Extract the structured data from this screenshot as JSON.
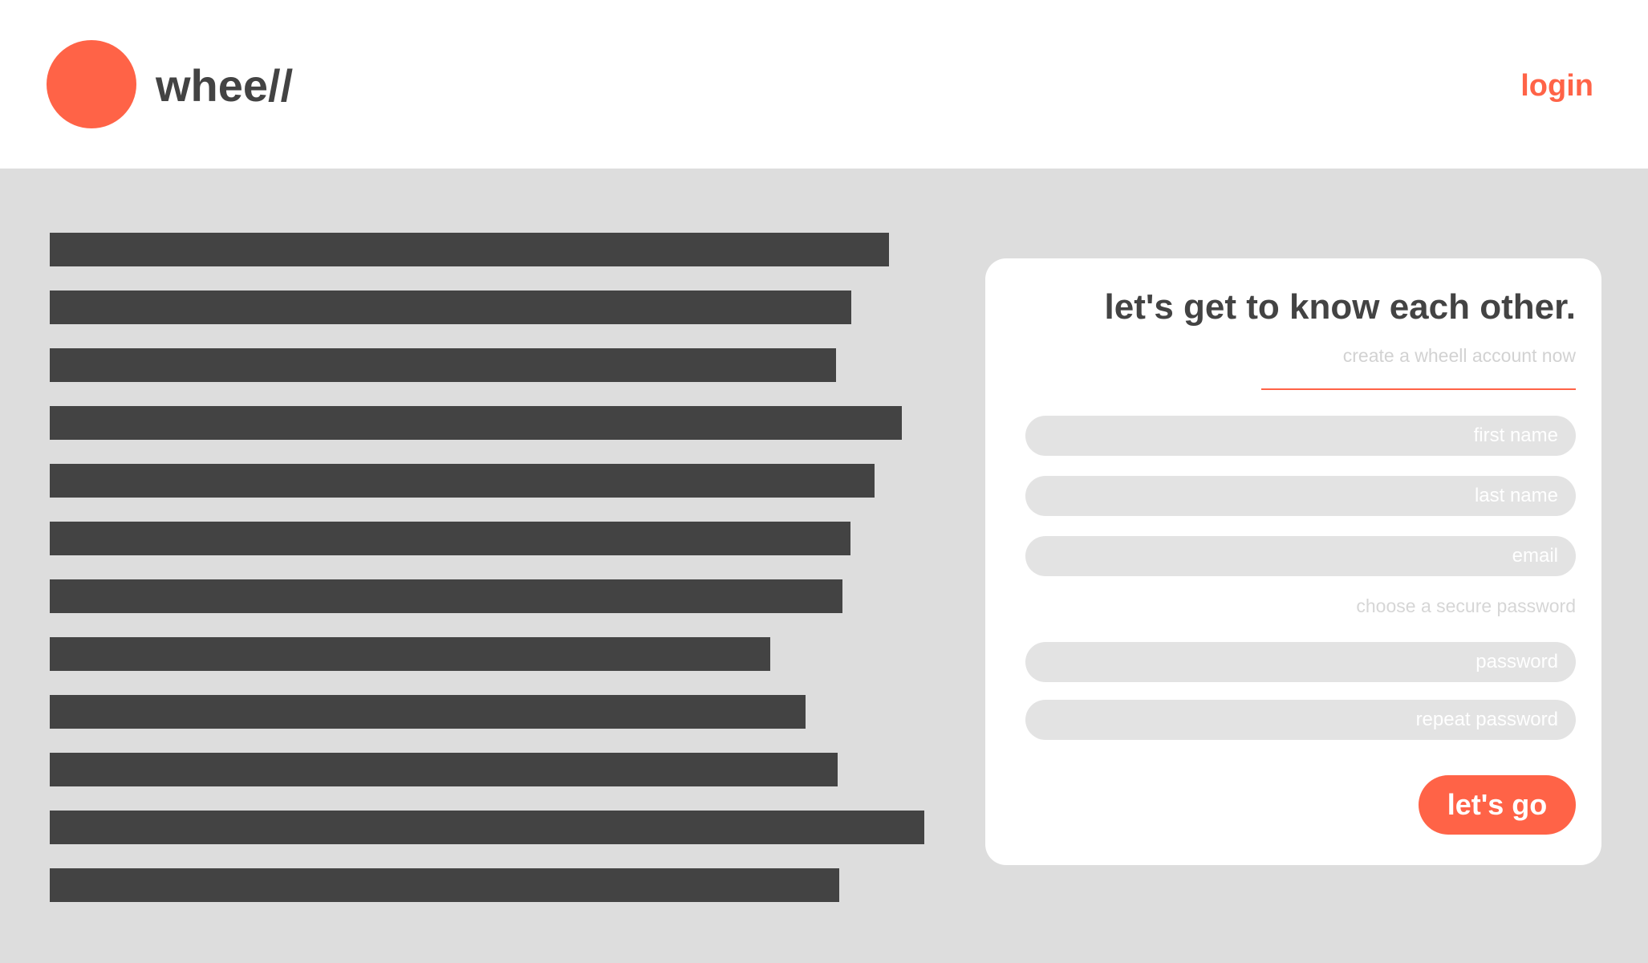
{
  "header": {
    "brand": "whee//",
    "login_label": "login"
  },
  "colors": {
    "accent": "#ff6347",
    "text_dark": "#434343",
    "background": "#dddddd",
    "field_bg": "#e3e3e3"
  },
  "signup": {
    "title": "let's get to know each other.",
    "subtitle": "create a wheell account now",
    "first_name_placeholder": "first name",
    "last_name_placeholder": "last name",
    "email_placeholder": "email",
    "password_section_label": "choose a secure password",
    "password_placeholder": "password",
    "repeat_password_placeholder": "repeat password",
    "submit_label": "let's go"
  }
}
